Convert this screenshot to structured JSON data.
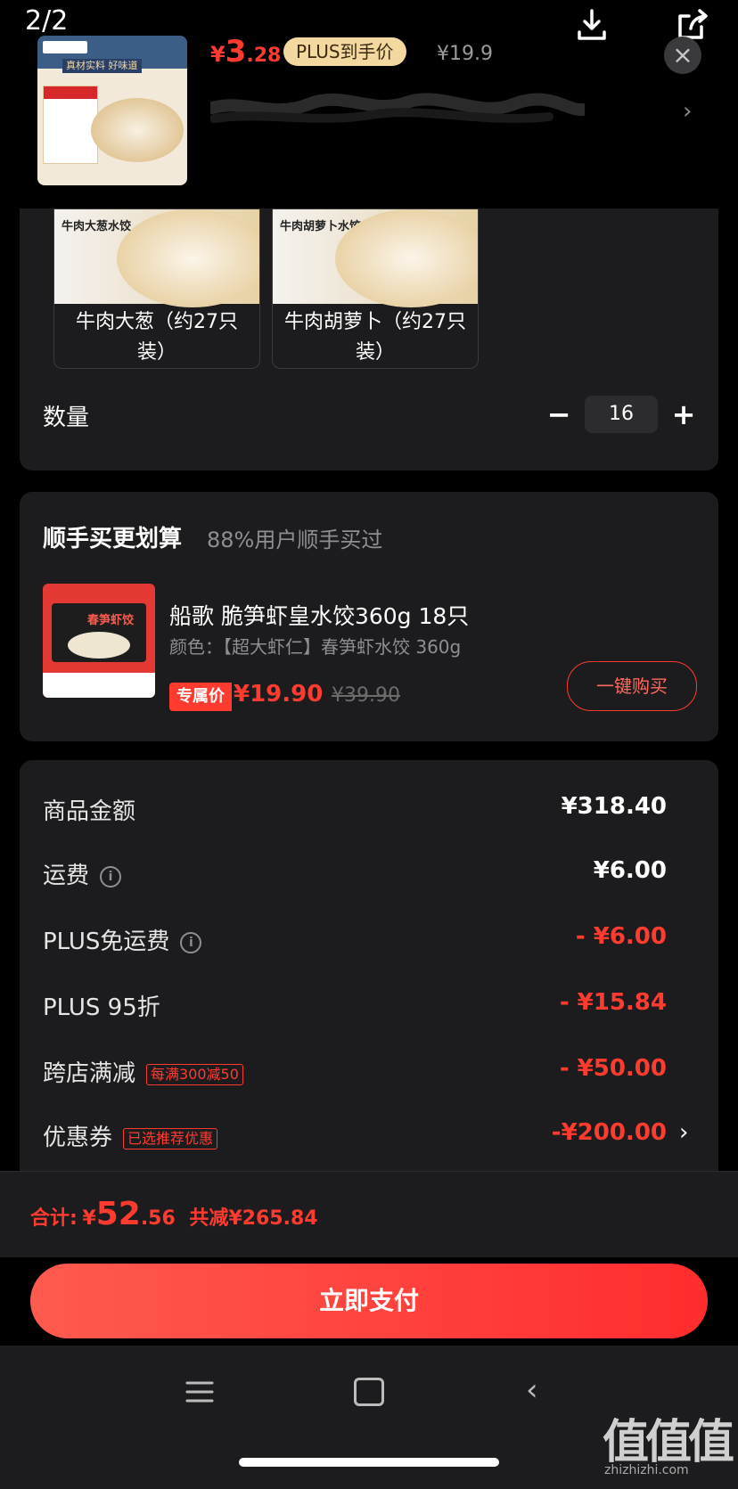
{
  "header": {
    "page_indicator": "2/2",
    "price_symbol": "¥",
    "price_int": "3",
    "price_dec": ".28",
    "plus_badge": "PLUS到手价",
    "original_price": "¥19.9",
    "close_glyph": "×",
    "thumb_banner": "真材实料 好味道"
  },
  "variants": [
    {
      "label": "牛肉大葱（约27只装）",
      "img_text": "牛肉大葱水饺"
    },
    {
      "label": "牛肉胡萝卜（约27只装）",
      "img_text": "牛肉胡萝卜水饺"
    }
  ],
  "quantity": {
    "label": "数量",
    "value": "16",
    "minus": "−",
    "plus": "+"
  },
  "recommend": {
    "title": "顺手买更划算",
    "subtitle": "88%用户顺手买过",
    "img_text": "春笋虾饺",
    "product_name": "船歌 脆笋虾皇水饺360g 18只",
    "spec": "颜色：【超大虾仁】春笋虾水饺 360g",
    "exclusive_tag": "专属价",
    "price": "¥19.90",
    "original_price": "¥39.90",
    "buy_label": "一键购买"
  },
  "summary": {
    "rows": [
      {
        "label": "商品金额",
        "value": "¥318.40"
      },
      {
        "label": "运费",
        "value": "¥6.00"
      },
      {
        "label": "PLUS免运费",
        "value": "- ¥6.00"
      },
      {
        "label": "PLUS 95折",
        "value": "- ¥15.84"
      },
      {
        "label": "跨店满减",
        "tag": "每满300减50",
        "value": "- ¥50.00"
      },
      {
        "label": "优惠券",
        "tag": "已选推荐优惠",
        "value": "-¥200.00"
      }
    ]
  },
  "footer": {
    "total_label": "合计:",
    "total_symbol": "¥",
    "total_int": "52",
    "total_dec": ".56",
    "saved": "共减¥265.84",
    "pay_label": "立即支付"
  },
  "watermark": {
    "text": "值值值",
    "site": "zhizhizhi.com"
  },
  "colors": {
    "accent": "#ff3b30",
    "card": "#1c1c1e",
    "background": "#000000",
    "plus_gold": "#f3d8a0"
  },
  "icons": [
    "download-icon",
    "share-icon",
    "close-icon",
    "chevron-right-icon",
    "info-icon",
    "menu-icon",
    "home-icon",
    "back-icon"
  ]
}
